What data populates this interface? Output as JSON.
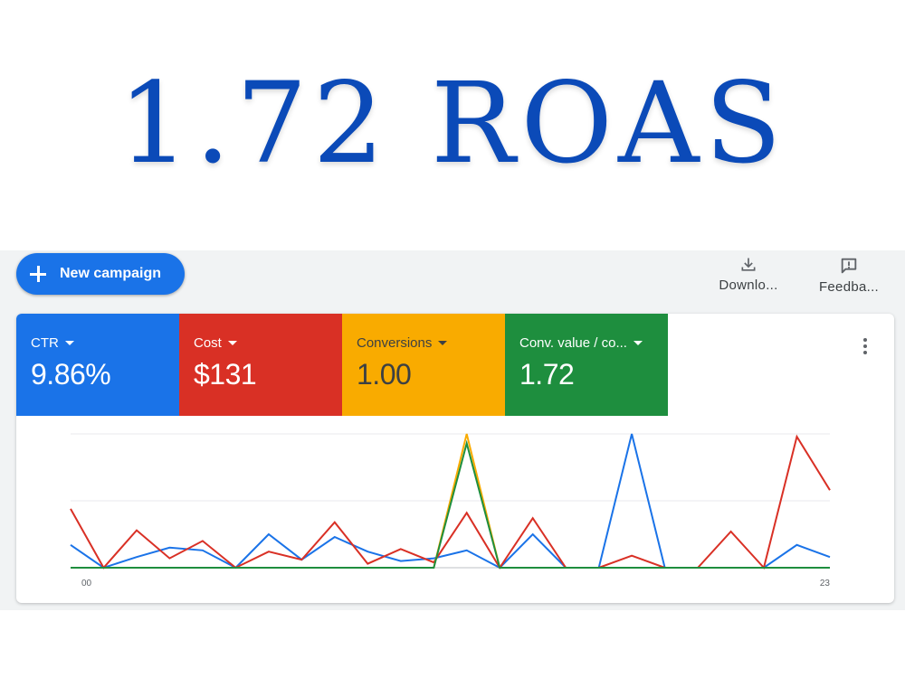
{
  "headline": "1.72 ROAS",
  "toolbar": {
    "new_campaign_label": "New campaign",
    "download_label": "Downlo...",
    "feedback_label": "Feedba..."
  },
  "metrics": [
    {
      "name": "CTR",
      "value": "9.86%",
      "bg": "#1a73e8",
      "fg": "#ffffff"
    },
    {
      "name": "Cost",
      "value": "$131",
      "bg": "#d93025",
      "fg": "#ffffff"
    },
    {
      "name": "Conversions",
      "value": "1.00",
      "bg": "#f9ab00",
      "fg": "#3c4043"
    },
    {
      "name": "Conv. value / co...",
      "value": "1.72",
      "bg": "#1e8e3e",
      "fg": "#ffffff"
    }
  ],
  "chart_data": {
    "type": "line",
    "x": [
      0,
      1,
      2,
      3,
      4,
      5,
      6,
      7,
      8,
      9,
      10,
      11,
      12,
      13,
      14,
      15,
      16,
      17,
      18,
      19,
      20,
      21,
      22,
      23
    ],
    "x_tick_labels": [
      "00",
      "23"
    ],
    "grid": true,
    "series": [
      {
        "color": "#1a73e8",
        "values": [
          0.17,
          0,
          0.08,
          0.15,
          0.13,
          0,
          0.25,
          0.06,
          0.23,
          0.12,
          0.05,
          0.07,
          0.13,
          0,
          0.25,
          0,
          0,
          1.0,
          0,
          0,
          0,
          0,
          0.17,
          0.08
        ]
      },
      {
        "color": "#d93025",
        "values": [
          0.44,
          0,
          0.28,
          0.07,
          0.2,
          0,
          0.12,
          0.06,
          0.34,
          0.03,
          0.14,
          0.04,
          0.41,
          0,
          0.37,
          0,
          0,
          0.09,
          0,
          0,
          0.27,
          0,
          0.98,
          0.58
        ]
      },
      {
        "color": "#f9ab00",
        "values": [
          0,
          0,
          0,
          0,
          0,
          0,
          0,
          0,
          0,
          0,
          0,
          0,
          1.0,
          0,
          0,
          0,
          0,
          0,
          0,
          0,
          0,
          0,
          0,
          0
        ]
      },
      {
        "color": "#1e8e3e",
        "values": [
          0,
          0,
          0,
          0,
          0,
          0,
          0,
          0,
          0,
          0,
          0,
          0,
          0.93,
          0,
          0,
          0,
          0,
          0,
          0,
          0,
          0,
          0,
          0,
          0
        ]
      }
    ]
  }
}
